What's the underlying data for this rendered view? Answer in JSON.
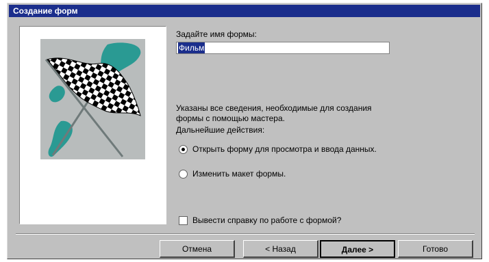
{
  "window": {
    "title": "Создание форм"
  },
  "picture": {
    "icon": "checkered-flag-icon"
  },
  "name_label": "Задайте имя формы:",
  "name_value": "Фильм",
  "info_text_1": "Указаны все сведения, необходимые для создания",
  "info_text_2": "формы с помощью мастера.",
  "next_action_label": "Дальнейшие действия:",
  "radio_open": {
    "label": "Открыть форму для просмотра и ввода данных.",
    "selected": true
  },
  "radio_modify": {
    "label": "Изменить макет формы.",
    "selected": false
  },
  "help_checkbox": {
    "label": "Вывести справку по работе с формой?",
    "checked": false
  },
  "buttons": {
    "cancel": "Отмена",
    "back": "< Назад",
    "next": "Далее >",
    "finish": "Готово"
  },
  "colors": {
    "titlebar": "#1b2e8c",
    "dialog": "#c0c0c0",
    "flag_green": "#2a9a93"
  }
}
